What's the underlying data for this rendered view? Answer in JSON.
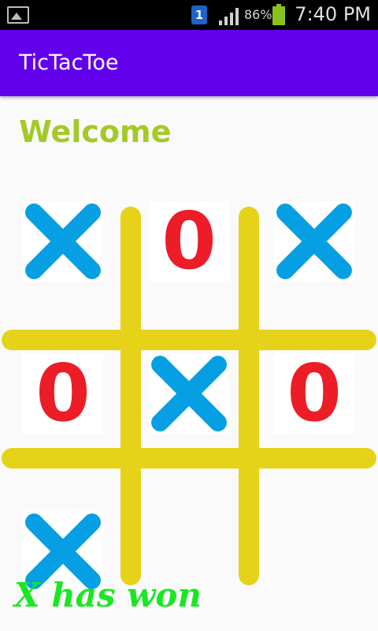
{
  "status_bar": {
    "notification_count": "1",
    "battery_percent": "86%",
    "time": "7:40 PM"
  },
  "app": {
    "title": "TicTacToe"
  },
  "welcome_text": "Welcome",
  "board": {
    "cells": [
      "X",
      "O",
      "X",
      "O",
      "X",
      "O",
      "X",
      "",
      ""
    ]
  },
  "game_status": "X has won",
  "colors": {
    "app_bar": "#6200ee",
    "welcome": "#a4c928",
    "grid": "#e6d219",
    "x_mark": "#069fe3",
    "o_mark": "#ec1d27",
    "status": "#18e821"
  }
}
